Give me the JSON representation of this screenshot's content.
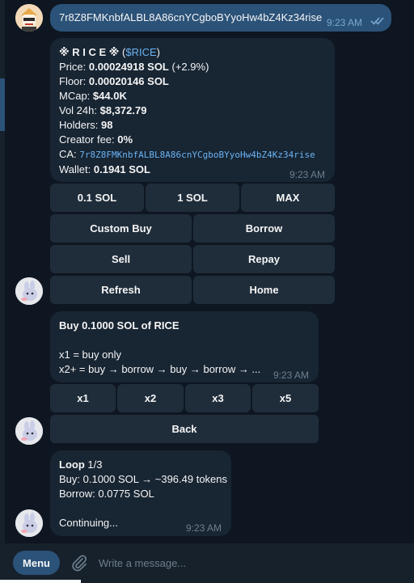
{
  "sent_message": {
    "text": "7r8Z8FMKnbfALBL8A86cnYCgboBYyoHw4bZ4Kz34rise",
    "time": "9:23 AM"
  },
  "token_card": {
    "name": "※ R I C E ※",
    "open_paren": "(",
    "ticker": "$RICE",
    "close_paren": ")",
    "price_label": "Price:",
    "price_value": "0.00024918 SOL",
    "price_change": "(+2.9%)",
    "floor_label": "Floor:",
    "floor_value": "0.00020146 SOL",
    "mcap_label": "MCap:",
    "mcap_value": "$44.0K",
    "vol_label": "Vol 24h:",
    "vol_value": "$8,372.79",
    "holders_label": "Holders:",
    "holders_value": "98",
    "fee_label": "Creator fee:",
    "fee_value": "0%",
    "ca_label": "CA:",
    "ca_value": "7r8Z8FMKnbfALBL8A86cnYCgboBYyoHw4bZ4Kz34rise",
    "wallet_label": "Wallet:",
    "wallet_value": "0.1941 SOL",
    "time": "9:23 AM"
  },
  "keyboard_main": {
    "amount_1": "0.1 SOL",
    "amount_2": "1 SOL",
    "amount_3": "MAX",
    "custom_buy": "Custom Buy",
    "borrow": "Borrow",
    "sell": "Sell",
    "repay": "Repay",
    "refresh": "Refresh",
    "home": "Home"
  },
  "buy_card": {
    "title": "Buy 0.1000 SOL of RICE",
    "line1": "x1 = buy only",
    "line2": "x2+ = buy → borrow → buy → borrow → ...",
    "time": "9:23 AM"
  },
  "keyboard_loop": {
    "x1": "x1",
    "x2": "x2",
    "x3": "x3",
    "x5": "x5",
    "back": "Back"
  },
  "loop_card": {
    "loop_label": "Loop",
    "loop_count": "1/3",
    "buy_line": "Buy: 0.1000 SOL → ~396.49 tokens",
    "borrow_line": "Borrow: 0.0775 SOL",
    "status": "Continuing...",
    "time": "9:23 AM"
  },
  "composer": {
    "menu_label": "Menu",
    "placeholder": "Write a message..."
  },
  "icons": {
    "read_receipt": "double-check-icon",
    "attach": "paperclip-icon"
  },
  "colors": {
    "background": "#0e1621",
    "incoming_bubble": "#182533",
    "outgoing_bubble": "#2b5278",
    "keyboard_button": "#1f2d3b",
    "link": "#6ab3f3",
    "muted": "#6d7f8f"
  }
}
